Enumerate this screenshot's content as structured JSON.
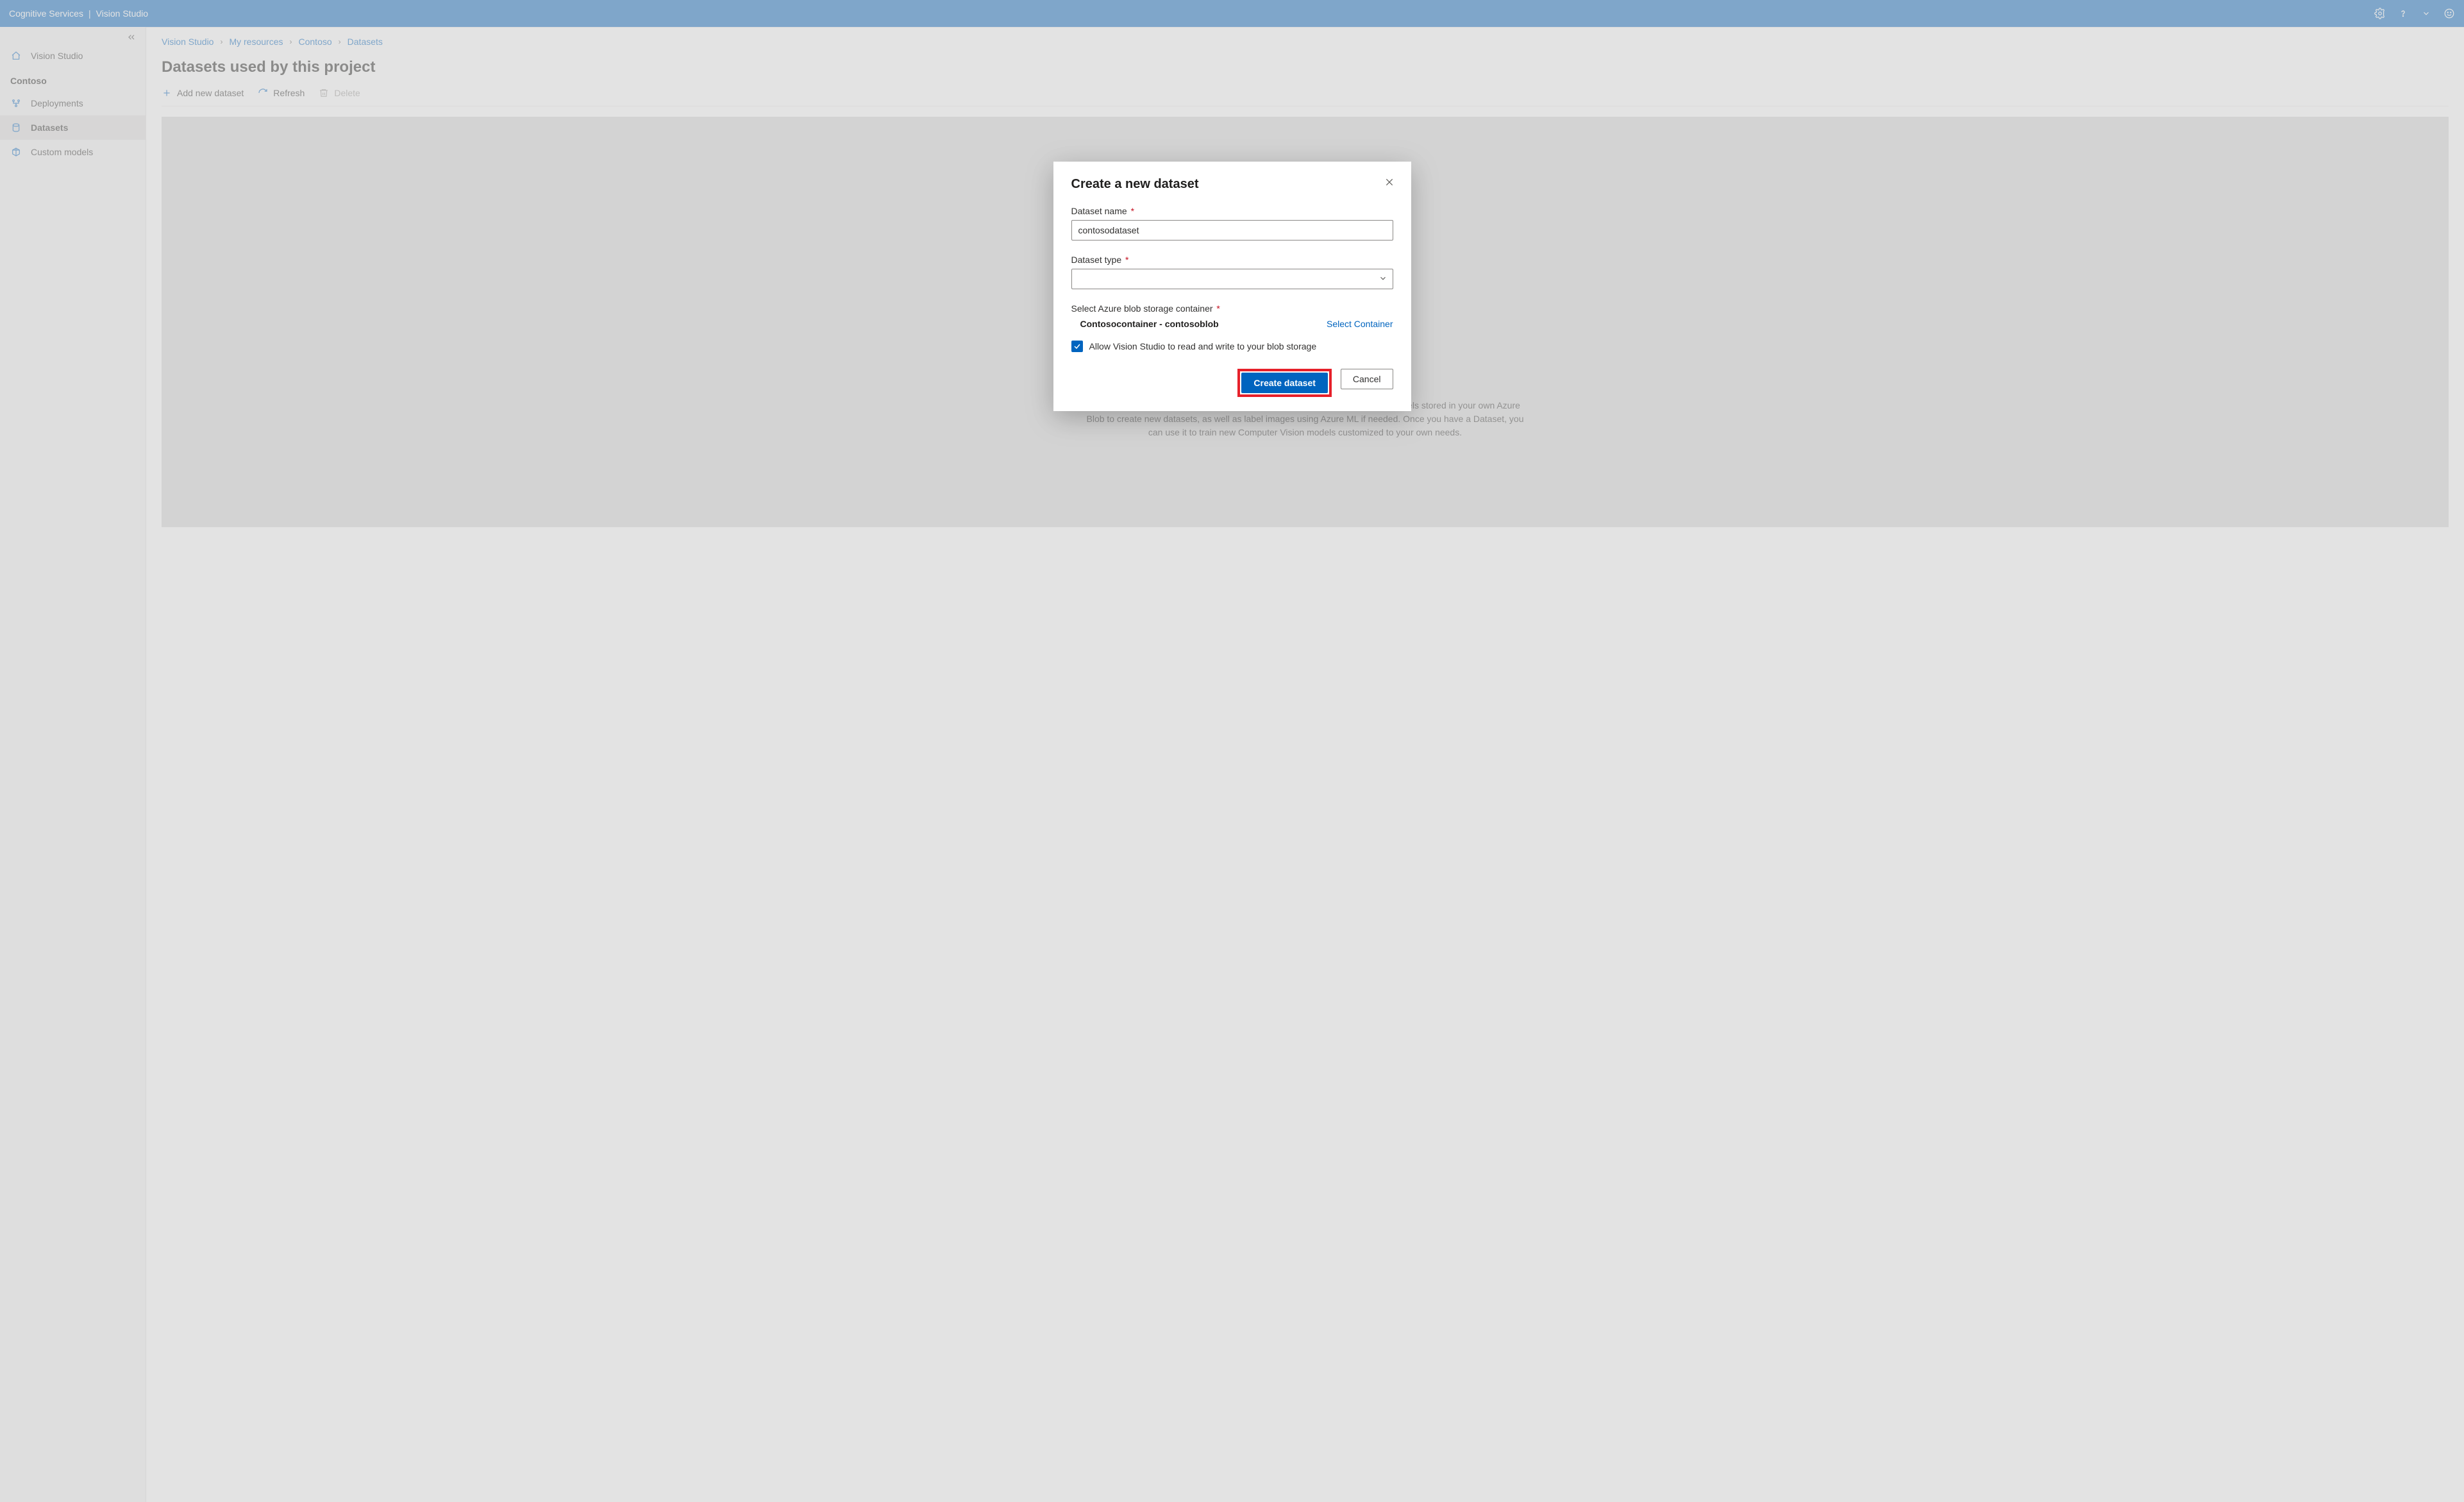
{
  "topbar": {
    "brand": "Cognitive Services",
    "product": "Vision Studio"
  },
  "sidebar": {
    "home_label": "Vision Studio",
    "resource_heading": "Contoso",
    "items": [
      {
        "label": "Deployments"
      },
      {
        "label": "Datasets"
      },
      {
        "label": "Custom models"
      }
    ]
  },
  "breadcrumb": {
    "items": [
      "Vision Studio",
      "My resources",
      "Contoso",
      "Datasets"
    ]
  },
  "page": {
    "title": "Datasets used by this project",
    "info_text": "Create a new dataset to get started. You will be able to leverage images and labels stored in your own Azure Blob to create new datasets, as well as label images using Azure ML if needed. Once you have a Dataset, you can use it to train new Computer Vision models customized to your own needs."
  },
  "toolbar": {
    "add_label": "Add new dataset",
    "refresh_label": "Refresh",
    "delete_label": "Delete"
  },
  "modal": {
    "title": "Create a new dataset",
    "name_label": "Dataset name",
    "name_value": "contosodataset",
    "type_label": "Dataset type",
    "type_value": "",
    "storage_label": "Select Azure blob storage container",
    "storage_value": "Contosocontainer - contosoblob",
    "select_container_link": "Select Container",
    "allow_label": "Allow Vision Studio to read and write to your blob storage",
    "allow_checked": true,
    "create_label": "Create dataset",
    "cancel_label": "Cancel"
  }
}
